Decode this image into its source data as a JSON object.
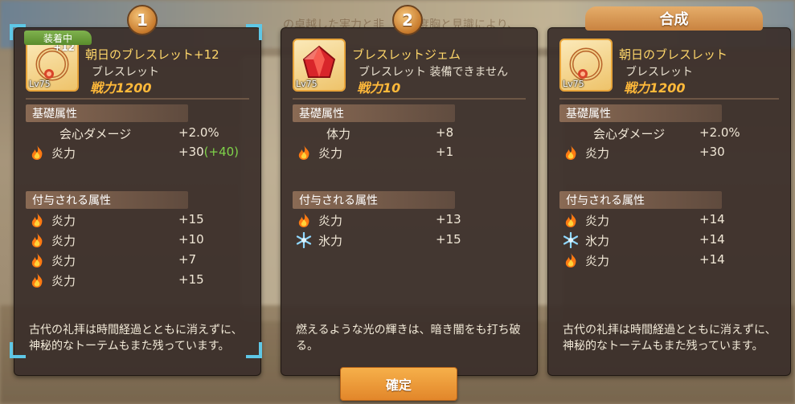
{
  "badges": {
    "left": "1",
    "middle": "2"
  },
  "merge_title": "合成",
  "equipped_label": "装着中",
  "confirm_label": "確定",
  "background_text": {
    "top": "の卓越した実力と非",
    "top2": "度胸と見識により、"
  },
  "panels": [
    {
      "level": "Lv75",
      "plus": "+12",
      "name": "朝日のブレスレット+12",
      "type": "ブレスレット",
      "power": "戦力1200",
      "base_header": "基礎属性",
      "base_stats": [
        {
          "label": "会心ダメージ",
          "value": "+2.0%",
          "bonus": "",
          "icon": "none"
        },
        {
          "label": "炎力",
          "value": "+30",
          "bonus": "(+40)",
          "icon": "fire-icon"
        }
      ],
      "extra_header": "付与される属性",
      "extra_stats": [
        {
          "label": "炎力",
          "value": "+15",
          "icon": "fire-icon"
        },
        {
          "label": "炎力",
          "value": "+10",
          "icon": "fire-icon"
        },
        {
          "label": "炎力",
          "value": "+7",
          "icon": "fire-icon"
        },
        {
          "label": "炎力",
          "value": "+15",
          "icon": "fire-icon"
        }
      ],
      "description": "古代の礼拝は時間経過とともに消えずに、神秘的なトーテムもまた残っています。"
    },
    {
      "level": "Lv75",
      "name": "ブレスレットジェム",
      "type": "ブレスレット 装備できません",
      "power": "戦力10",
      "base_header": "基礎属性",
      "base_stats": [
        {
          "label": "体力",
          "value": "+8",
          "icon": "none"
        },
        {
          "label": "炎力",
          "value": "+1",
          "icon": "fire-icon"
        }
      ],
      "extra_header": "付与される属性",
      "extra_stats": [
        {
          "label": "炎力",
          "value": "+13",
          "icon": "fire-icon"
        },
        {
          "label": "氷力",
          "value": "+15",
          "icon": "ice-icon"
        }
      ],
      "description": "燃えるような光の輝きは、暗き闇をも打ち破る。"
    },
    {
      "level": "Lv75",
      "name": "朝日のブレスレット",
      "type": "ブレスレット",
      "power": "戦力1200",
      "base_header": "基礎属性",
      "base_stats": [
        {
          "label": "会心ダメージ",
          "value": "+2.0%",
          "icon": "none"
        },
        {
          "label": "炎力",
          "value": "+30",
          "icon": "fire-icon"
        }
      ],
      "extra_header": "付与される属性",
      "extra_stats": [
        {
          "label": "炎力",
          "value": "+14",
          "icon": "fire-icon"
        },
        {
          "label": "氷力",
          "value": "+14",
          "icon": "ice-icon"
        },
        {
          "label": "炎力",
          "value": "+14",
          "icon": "fire-icon"
        }
      ],
      "description": "古代の礼拝は時間経過とともに消えずに、神秘的なトーテムもまた残っています。"
    }
  ],
  "colors": {
    "panel_bg": "#3a2e2a",
    "name_gold": "#ffd76a",
    "power_orange": "#ffb93a",
    "bonus_green": "#7fd34a",
    "confirm_orange": "#e2862a",
    "equip_corner_cyan": "#5ec7e6"
  }
}
